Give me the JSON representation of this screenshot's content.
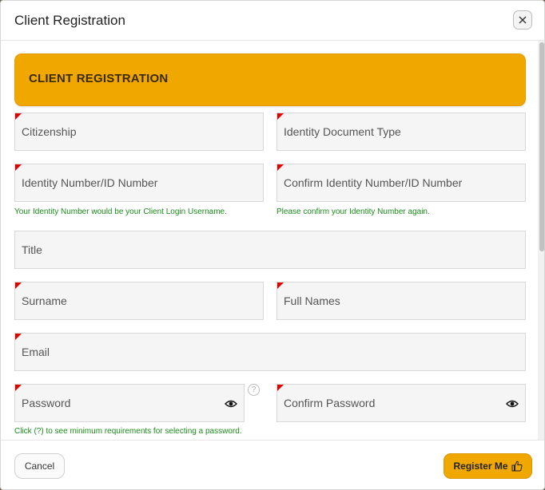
{
  "header": {
    "title": "Client Registration"
  },
  "banner": {
    "title": "CLIENT REGISTRATION"
  },
  "fields": {
    "citizenship": "Citizenship",
    "identity_document_type": "Identity Document Type",
    "identity_number": "Identity Number/ID Number",
    "confirm_identity_number": "Confirm Identity Number/ID Number",
    "title": "Title",
    "surname": "Surname",
    "full_names": "Full Names",
    "email": "Email",
    "password": "Password",
    "confirm_password": "Confirm Password"
  },
  "hints": {
    "identity_number": "Your Identity Number would be your Client Login Username.",
    "confirm_identity_number": "Please confirm your Identity Number again.",
    "password": "Click (?) to see minimum requirements for selecting a password.",
    "help_symbol": "?"
  },
  "footer": {
    "cancel_label": "Cancel",
    "register_label": "Register Me"
  },
  "colors": {
    "accent": "#f0a800",
    "required_marker": "#e00000",
    "hint_text": "#1a8a1a"
  },
  "icons": {
    "close": "close-icon",
    "eye": "eye-icon",
    "help": "help-icon",
    "thumbs_up": "thumbs-up-icon"
  }
}
